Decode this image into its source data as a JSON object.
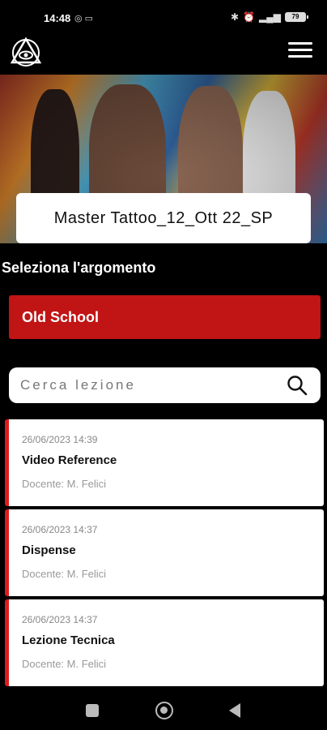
{
  "status_bar": {
    "time": "14:48",
    "left_icons": [
      "instagram-icon",
      "screen-icon"
    ],
    "right_icons": [
      "bluetooth-icon",
      "alarm-icon",
      "signal-icon"
    ],
    "battery": "79"
  },
  "header": {
    "logo_icon": "eye-triangle-logo-icon",
    "menu_icon": "hamburger-menu-icon"
  },
  "hero": {
    "course_title": "Master Tattoo_12_Ott 22_SP"
  },
  "section": {
    "title": "Seleziona l'argomento"
  },
  "topic": {
    "selected_label": "Old School",
    "color": "#c11414"
  },
  "search": {
    "placeholder": "Cerca lezione"
  },
  "lessons": [
    {
      "date": "26/06/2023 14:39",
      "title": "Video Reference",
      "teacher": "Docente: M. Felici"
    },
    {
      "date": "26/06/2023 14:37",
      "title": "Dispense",
      "teacher": "Docente: M. Felici"
    },
    {
      "date": "26/06/2023 14:37",
      "title": "Lezione Tecnica",
      "teacher": "Docente: M. Felici"
    }
  ],
  "accent_color": "#e01b1b"
}
